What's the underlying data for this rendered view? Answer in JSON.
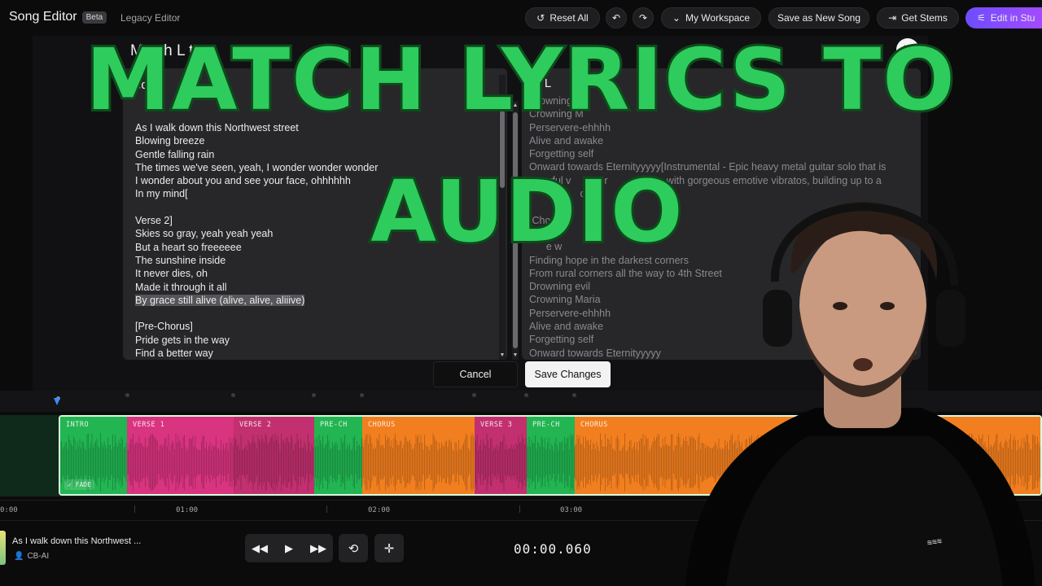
{
  "header": {
    "brand": "Song Editor",
    "beta_badge": "Beta",
    "legacy_link": "Legacy Editor",
    "reset_all": "Reset All",
    "workspace": "My Workspace",
    "save_as_new": "Save as New Song",
    "get_stems": "Get Stems",
    "edit_in_studio": "Edit in Stu"
  },
  "modal": {
    "title": "Match L    to",
    "left_heading": "edi    s",
    "right_heading": "al L",
    "left_lyrics": [
      "As I walk down this Northwest street",
      "Blowing breeze",
      "Gentle falling rain",
      "The times we've seen, yeah, I wonder wonder wonder",
      "I wonder about you and see your face, ohhhhhh",
      "In my mind[",
      "",
      "Verse 2]",
      "Skies so gray, yeah yeah yeah",
      "But a heart so freeeeee",
      "The sunshine inside",
      "It never dies, oh",
      "Made it through it all",
      "By grace still alive (alive, alive, aliiive)",
      "",
      "[Pre-Chorus]",
      "Pride gets in the way",
      "Find a better way"
    ],
    "highlighted_line_index": 13,
    "right_lyrics": [
      "Drowning e",
      "Crowning M",
      "Perservere-ehhhh",
      "Alive and awake",
      "Forgetting self",
      "Onward towards Eternityyyyy[Instrumental - Epic heavy metal guitar solo that is",
      "     erful v        xer            aing, with gorgeous emotive vibratos, building up to a",
      "                  c",
      "",
      "[Cho",
      "Sta",
      "      e w",
      "Finding hope in the darkest corners",
      "From rural corners all the way to 4th Street",
      "Drowning evil",
      "Crowning Maria",
      "Perservere-ehhhh",
      "Alive and awake",
      "Forgetting self",
      "Onward towards Eternityyyyy"
    ],
    "cancel": "Cancel",
    "save_changes": "Save Changes"
  },
  "timeline": {
    "sections": [
      {
        "label": "INTRO",
        "color": "#22b552"
      },
      {
        "label": "VERSE 1",
        "color": "#d9347f"
      },
      {
        "label": "VERSE 2",
        "color": "#c2306f"
      },
      {
        "label": "PRE-CH",
        "color": "#22b552"
      },
      {
        "label": "CHORUS",
        "color": "#f27f1f"
      },
      {
        "label": "VERSE 3",
        "color": "#c2306f"
      },
      {
        "label": "PRE-CH",
        "color": "#22b552"
      },
      {
        "label": "CHORUS",
        "color": "#f27f1f"
      }
    ],
    "fade_badge": "✓ FADE",
    "ruler_labels": [
      "0:00",
      "01:00",
      "02:00",
      "03:00"
    ]
  },
  "player": {
    "track_title": "As I walk down this Northwest ...",
    "artist": "CB-AI",
    "current_time": "00:00.060"
  },
  "overlay": {
    "line1": "MATCH LYRICS TO",
    "line2": "AUDIO"
  },
  "colors": {
    "accent_green": "#2ecc5c",
    "caption_stroke": "#0e4a1c",
    "studio_gradient_start": "#6d4dff",
    "studio_gradient_end": "#a34bff"
  }
}
